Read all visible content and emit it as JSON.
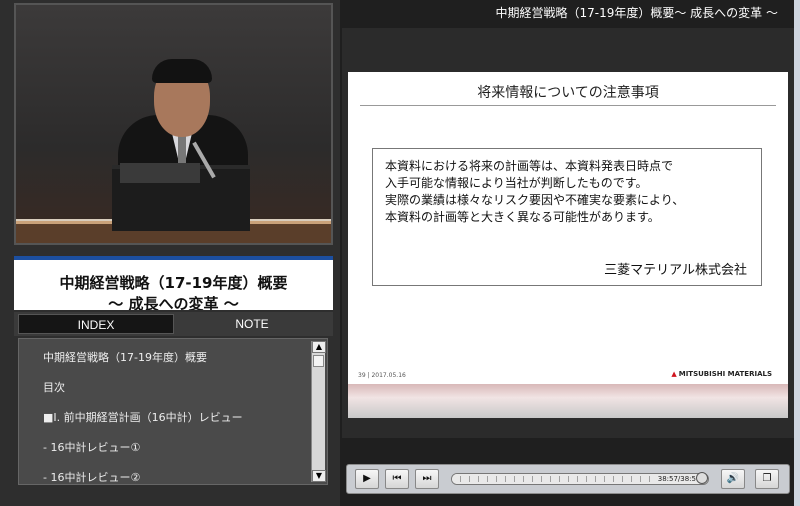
{
  "header": {
    "title": "中期経営戦略（17-19年度）概要～ 成長への変革 ～"
  },
  "presentation": {
    "title_line1": "中期経営戦略（17-19年度）概要",
    "title_line2": "～ 成長への変革 ～"
  },
  "tabs": [
    {
      "label": "INDEX",
      "active": true
    },
    {
      "label": "NOTE",
      "active": false
    }
  ],
  "index_items": [
    "中期経営戦略（17-19年度）概要",
    "目次",
    "■Ⅰ. 前中期経営計画（16中計）レビュー",
    "- 16中計レビュー①",
    "- 16中計レビュー②"
  ],
  "slide": {
    "title": "将来情報についての注意事項",
    "notice_lines": [
      "本資料における将来の計画等は、本資料発表日時点で",
      "入手可能な情報により当社が判断したものです。",
      "実際の業績は様々なリスク要因や不確実な要素により、",
      "本資料の計画等と大きく異なる可能性があります。"
    ],
    "company": "三菱マテリアル株式会社",
    "footer": "39 | 2017.05.16",
    "brand": "MITSUBISHI MATERIALS"
  },
  "player": {
    "time": "38:57/38:5",
    "progress": 0.99,
    "icons": {
      "play": "play-icon",
      "prev": "previous-icon",
      "next": "next-icon",
      "volume": "volume-icon",
      "window": "window-icon"
    }
  },
  "colors": {
    "accent_blue": "#1c4fa0",
    "brand_red": "#d0141e"
  }
}
